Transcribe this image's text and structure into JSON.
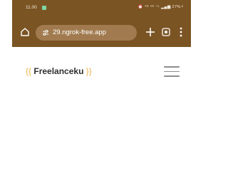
{
  "status_bar": {
    "time": "11.00",
    "right_text": "⏰ ⁴ᴳ ⁵ᴳ ⁺ᴸ ▂▄▆ 27%⚡"
  },
  "browser": {
    "url": "29.ngrok-free.app"
  },
  "site": {
    "logo_open": "{{",
    "logo_name": "Freelanceku",
    "logo_close": "}}"
  },
  "colors": {
    "chrome": "#7b5424",
    "url_pill": "#a17b4f",
    "brace": "#f0b34a",
    "logo_text": "#2f2f2f",
    "hamburger": "#8d8d8d"
  }
}
